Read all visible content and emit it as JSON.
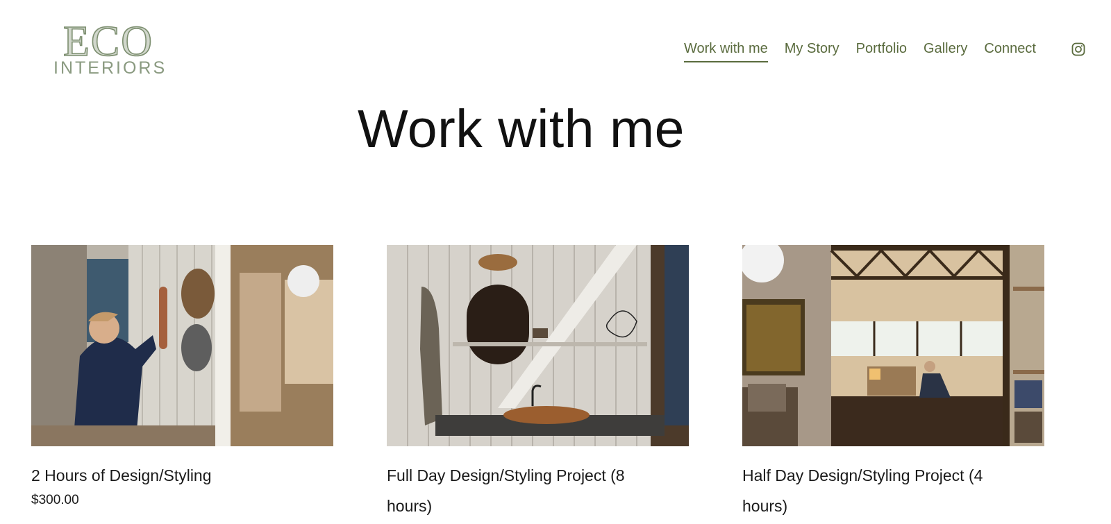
{
  "brand": {
    "logo_main": "ECO",
    "logo_sub": "INTERIORS",
    "logo_color": "#7d8f70"
  },
  "nav": {
    "items": [
      {
        "label": "Work with me",
        "active": true
      },
      {
        "label": "My Story"
      },
      {
        "label": "Portfolio"
      },
      {
        "label": "Gallery"
      },
      {
        "label": "Connect"
      }
    ],
    "social_icon": "instagram-icon",
    "color": "#5a6b3e"
  },
  "page": {
    "title": "Work with me"
  },
  "products": [
    {
      "title": "2 Hours of Design/Styling",
      "price": "$300.00",
      "image": "woman-hanging-hats-on-wall"
    },
    {
      "title": "Full Day Design/Styling Project (8 hours)",
      "price": "",
      "image": "bathroom-vanity-with-copper-basin"
    },
    {
      "title": "Half Day Design/Styling Project (4 hours)",
      "price": "",
      "image": "open-plan-living-room-with-woman"
    }
  ]
}
